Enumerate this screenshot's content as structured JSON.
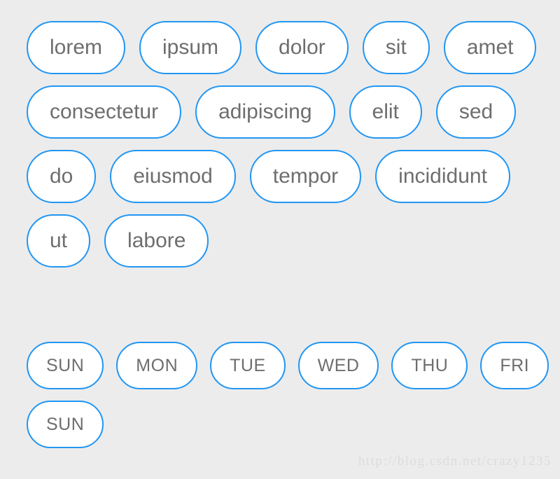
{
  "page": {
    "background_color": "#ececec",
    "watermark": "http://blog.csdn.net/crazy1235"
  },
  "chip_style": {
    "border_color": "#2196f3",
    "fill_color": "#ffffff",
    "text_color": "#6e6e6e"
  },
  "word_group": {
    "chips": [
      {
        "label": "lorem"
      },
      {
        "label": "ipsum"
      },
      {
        "label": "dolor"
      },
      {
        "label": "sit"
      },
      {
        "label": "amet"
      },
      {
        "label": "consectetur"
      },
      {
        "label": "adipiscing"
      },
      {
        "label": "elit"
      },
      {
        "label": "sed"
      },
      {
        "label": "do"
      },
      {
        "label": "eiusmod"
      },
      {
        "label": "tempor"
      },
      {
        "label": "incididunt"
      },
      {
        "label": "ut"
      },
      {
        "label": "labore"
      }
    ]
  },
  "day_group": {
    "chips": [
      {
        "label": "SUN"
      },
      {
        "label": "MON"
      },
      {
        "label": "TUE"
      },
      {
        "label": "WED"
      },
      {
        "label": "THU"
      },
      {
        "label": "FRI"
      },
      {
        "label": "SUN"
      }
    ]
  }
}
